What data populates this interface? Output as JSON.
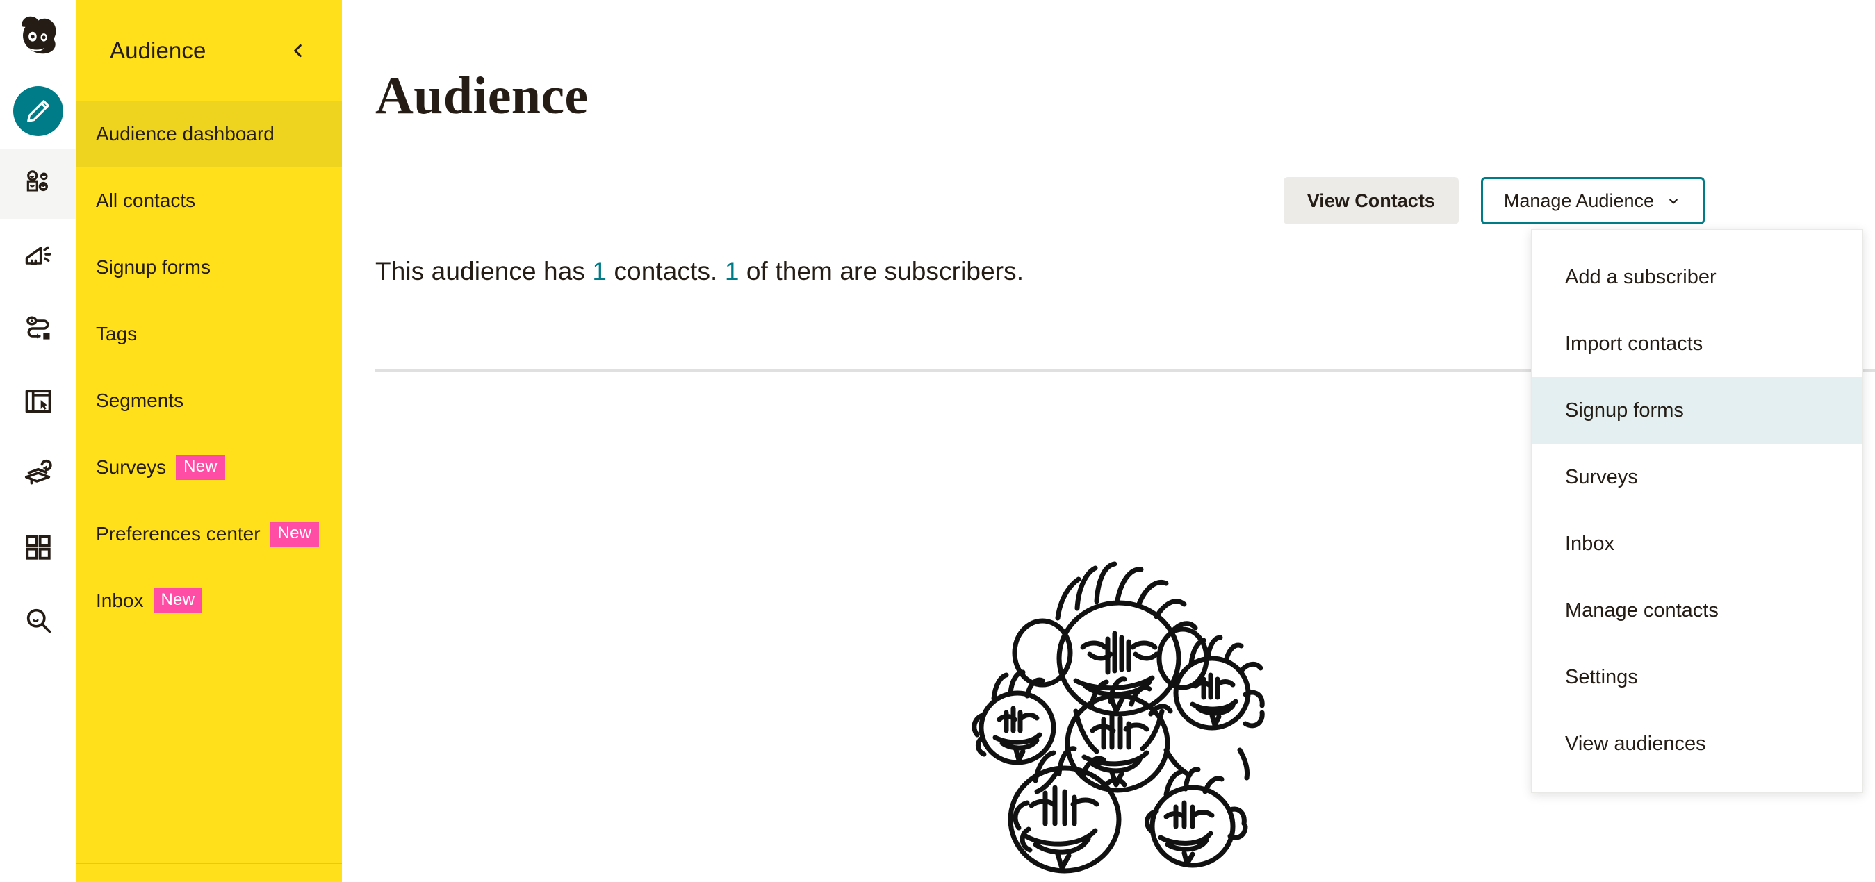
{
  "app": {
    "brand_icon": "mailchimp-freddie-logo",
    "accent_teal": "#007c89",
    "brand_yellow": "#ffe01b",
    "badge_pink": "#ff4da6"
  },
  "rail": {
    "items": [
      {
        "name": "create-icon",
        "label": "Create",
        "active": false
      },
      {
        "name": "audience-icon",
        "label": "Audience",
        "active": true
      },
      {
        "name": "campaigns-icon",
        "label": "Campaigns",
        "active": false
      },
      {
        "name": "automations-icon",
        "label": "Automations",
        "active": false
      },
      {
        "name": "website-icon",
        "label": "Website",
        "active": false
      },
      {
        "name": "content-icon",
        "label": "Content",
        "active": false
      },
      {
        "name": "integrations-icon",
        "label": "Integrations",
        "active": false
      },
      {
        "name": "search-icon",
        "label": "Search",
        "active": false
      }
    ]
  },
  "sidebar": {
    "title": "Audience",
    "collapse_icon": "chevron-left-icon",
    "items": [
      {
        "label": "Audience dashboard",
        "badge": null,
        "active": true
      },
      {
        "label": "All contacts",
        "badge": null,
        "active": false
      },
      {
        "label": "Signup forms",
        "badge": null,
        "active": false
      },
      {
        "label": "Tags",
        "badge": null,
        "active": false
      },
      {
        "label": "Segments",
        "badge": null,
        "active": false
      },
      {
        "label": "Surveys",
        "badge": "New",
        "active": false
      },
      {
        "label": "Preferences center",
        "badge": "New",
        "active": false
      },
      {
        "label": "Inbox",
        "badge": "New",
        "active": false
      }
    ]
  },
  "main": {
    "page_title": "Audience",
    "summary": {
      "prefix": "This audience has ",
      "contacts_count": "1",
      "middle": " contacts. ",
      "subscribers_count": "1",
      "suffix": " of them are subscribers."
    },
    "illustration_name": "group-of-people-illustration"
  },
  "toolbar": {
    "view_contacts_label": "View Contacts",
    "manage_audience_label": "Manage Audience",
    "manage_audience_caret": "chevron-down-icon"
  },
  "dropdown": {
    "open": true,
    "items": [
      {
        "label": "Add a subscriber",
        "highlighted": false
      },
      {
        "label": "Import contacts",
        "highlighted": false
      },
      {
        "label": "Signup forms",
        "highlighted": true
      },
      {
        "label": "Surveys",
        "highlighted": false
      },
      {
        "label": "Inbox",
        "highlighted": false
      },
      {
        "label": "Manage contacts",
        "highlighted": false
      },
      {
        "label": "Settings",
        "highlighted": false
      },
      {
        "label": "View audiences",
        "highlighted": false
      }
    ]
  }
}
